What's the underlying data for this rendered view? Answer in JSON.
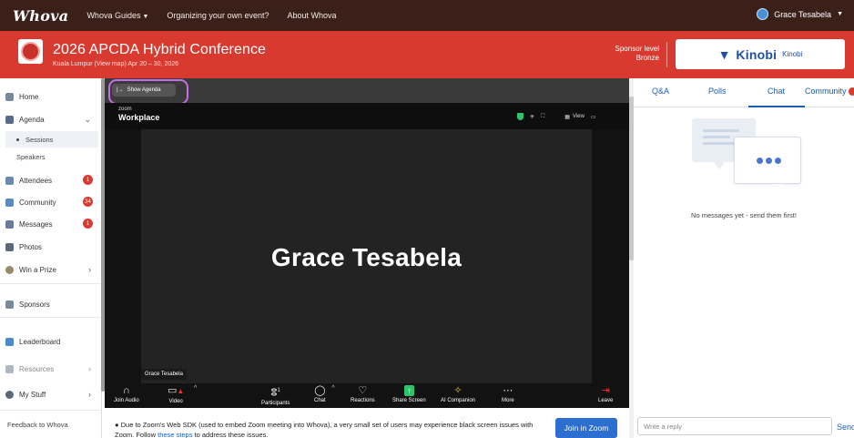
{
  "topnav": {
    "logo": "Whova",
    "links": [
      "Whova Guides",
      "Organizing your own event?",
      "About Whova"
    ],
    "user": "Grace Tesabela"
  },
  "event": {
    "title": "2026 APCDA Hybrid Conference",
    "subtitle": "Kuala Lumpur (View map)  Apr 20 – 30, 2026",
    "sponsor_level_label": "Sponsor level",
    "sponsor_level": "Bronze",
    "sponsor_name": "Kinobi",
    "sponsor_name_small": "Kinobi"
  },
  "sidebar": {
    "home": "Home",
    "agenda": "Agenda",
    "sessions": "Sessions",
    "speakers": "Speakers",
    "attendees": "Attendees",
    "attendees_badge": "1",
    "community": "Community",
    "community_badge": "34",
    "messages": "Messages",
    "messages_badge": "1",
    "photos": "Photos",
    "win_prize": "Win a Prize",
    "sponsors": "Sponsors",
    "leaderboard": "Leaderboard",
    "resources": "Resources",
    "my_stuff": "My Stuff",
    "feedback": "Feedback to Whova"
  },
  "video": {
    "show_agenda": "Show Agenda",
    "zoom_small": "zoom",
    "zoom_label": "Workplace",
    "view_label": "View",
    "participant_name": "Grace Tesabela",
    "participant_tag": "Grace Tesabela",
    "toolbar": {
      "join_audio": "Join Audio",
      "video": "Video",
      "participants": "Participants",
      "participants_count": "1",
      "chat": "Chat",
      "reactions": "Reactions",
      "share_screen": "Share Screen",
      "ai_companion": "AI Companion",
      "more": "More",
      "leave": "Leave"
    }
  },
  "notice": {
    "text_before": "Due to Zoom's Web SDK (used to embed Zoom meeting into Whova), a very small set of users may experience black screen issues with Zoom. Follow ",
    "link": "these steps",
    "text_after": " to address these issues.",
    "join_button": "Join in Zoom"
  },
  "right_panel": {
    "tabs": [
      "Q&A",
      "Polls",
      "Chat",
      "Community"
    ],
    "active_tab": "Chat",
    "empty_message": "No messages yet - send them first!",
    "reply_placeholder": "Write a reply",
    "send": "Send"
  },
  "colors": {
    "topnav": "#3a2018",
    "event_header": "#d83a2f",
    "accent_blue": "#1a5fb4",
    "badge": "#d83a2f",
    "highlight_ring": "#c86de8"
  }
}
